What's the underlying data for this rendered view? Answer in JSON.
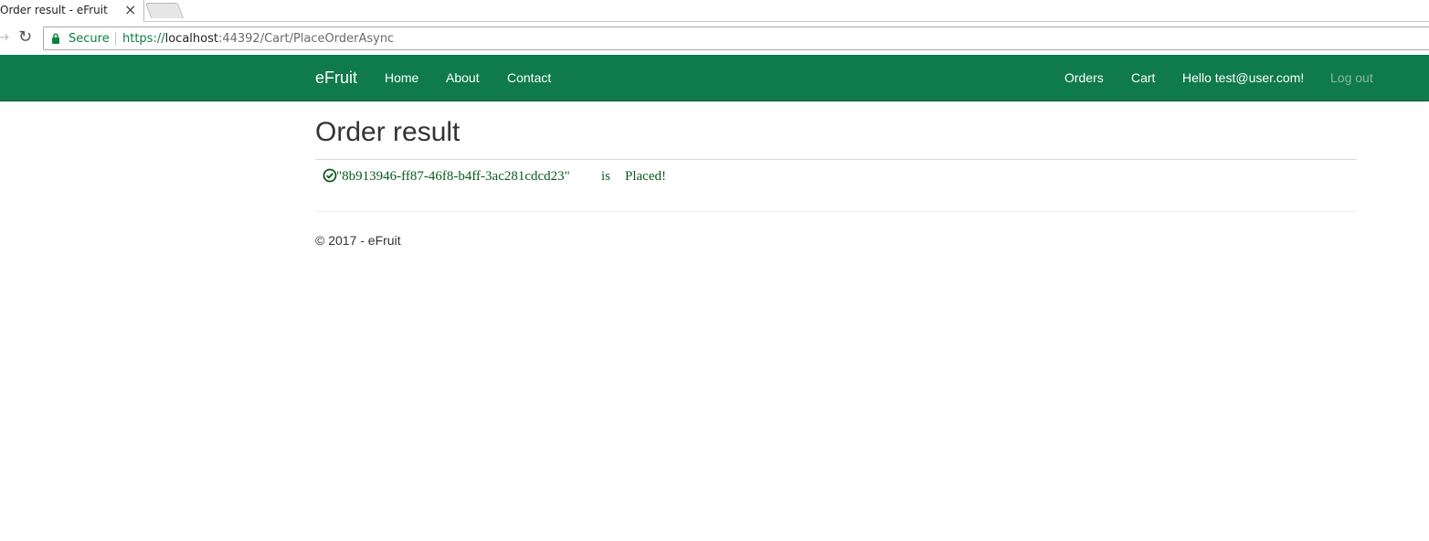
{
  "browser": {
    "tab_title": "Order result - eFruit",
    "tab_close": "×",
    "secure_label": "Secure",
    "url_scheme": "https://",
    "url_host": "localhost",
    "url_rest": ":44392/Cart/PlaceOrderAsync"
  },
  "navbar": {
    "brand": "eFruit",
    "links": [
      "Home",
      "About",
      "Contact"
    ],
    "right_links": [
      "Orders",
      "Cart",
      "Hello test@user.com!",
      "Log out"
    ],
    "background": "#0f7a4b"
  },
  "main": {
    "title": "Order result",
    "order_id": "\"8b913946-ff87-46f8-b4ff-3ac281cdcd23\"",
    "order_is": "is",
    "order_status": "Placed!",
    "status_color": "#0a5a1e",
    "status_icon": "check-circle-icon"
  },
  "footer": {
    "text": "© 2017 - eFruit"
  }
}
